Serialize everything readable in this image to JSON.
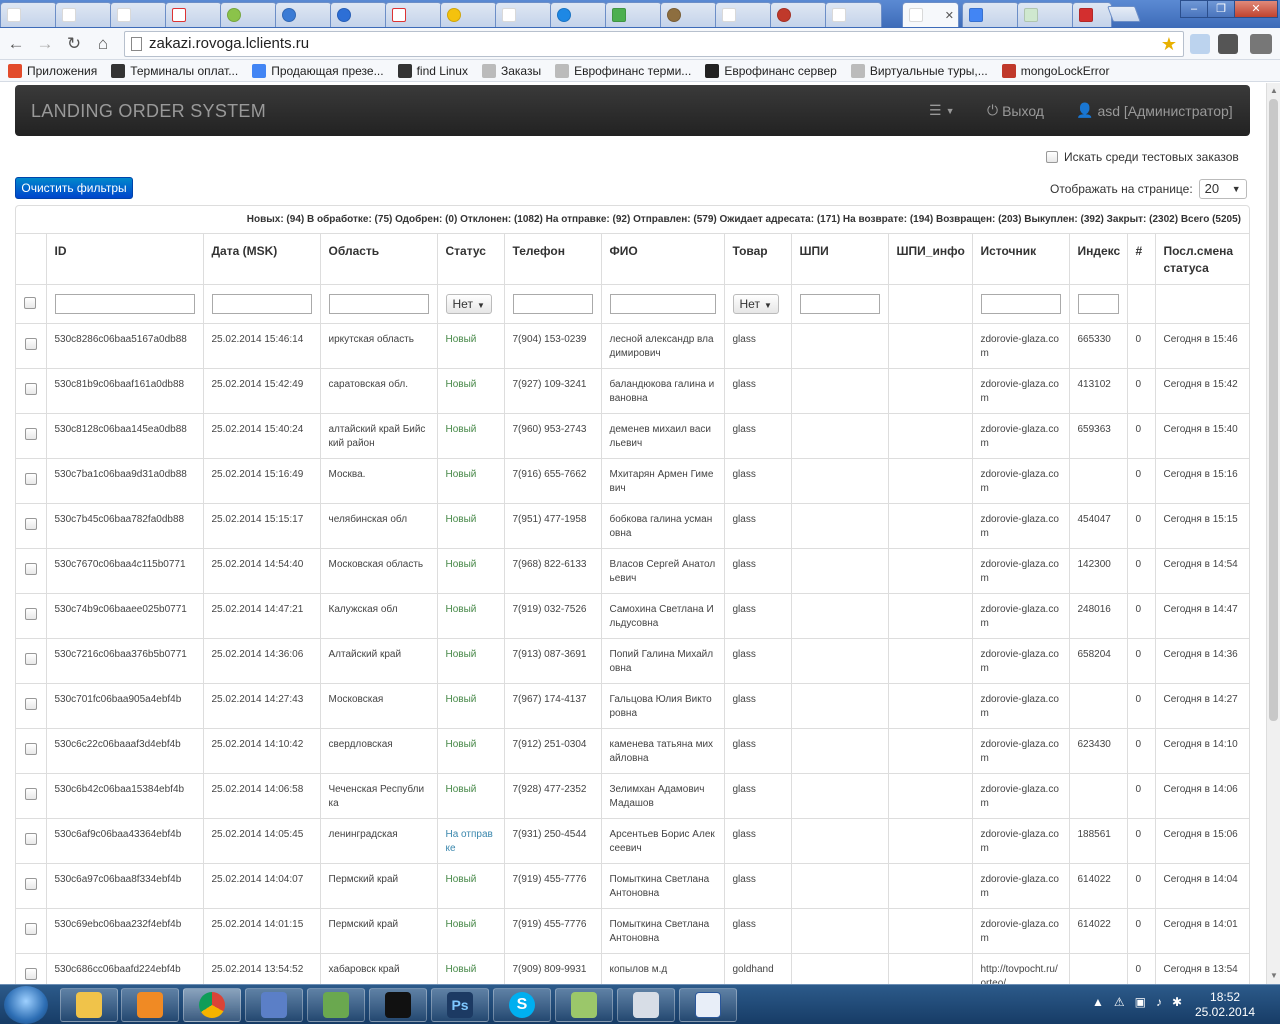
{
  "browser": {
    "url": "zakazi.rovoga.lclients.ru",
    "bookmarks": [
      {
        "label": "Приложения",
        "color": "#e24b2b"
      },
      {
        "label": "Терминалы оплат...",
        "color": "#333333"
      },
      {
        "label": "Продающая презе...",
        "color": "#4285f4"
      },
      {
        "label": "find Linux",
        "color": "#333333"
      },
      {
        "label": "Заказы",
        "color": "#bbbbbb"
      },
      {
        "label": "Еврофинанс терми...",
        "color": "#bbbbbb"
      },
      {
        "label": "Еврофинанс сервер",
        "color": "#222222"
      },
      {
        "label": "Виртуальные туры,...",
        "color": "#bbbbbb"
      },
      {
        "label": "mongoLockError",
        "color": "#c0392b"
      }
    ]
  },
  "app": {
    "brand": "LANDING ORDER SYSTEM",
    "logout": "Выход",
    "user": "asd [Администратор]",
    "search_test": "Искать среди тестовых заказов",
    "clear_filters": "Очистить фильтры",
    "per_page_label": "Отображать на странице:",
    "per_page_value": "20",
    "stats": "Новых: (94) В обработке: (75) Одобрен: (0) Отклонен: (1082) На отправке: (92) Отправлен: (579) Ожидает адресата: (171) На возврате: (194) Возвращен: (203) Выкуплен: (392) Закрыт: (2302) Всего (5205)",
    "filter_none": "Нет"
  },
  "table": {
    "columns": [
      "ID",
      "Дата (MSK)",
      "Область",
      "Статус",
      "Телефон",
      "ФИО",
      "Товар",
      "ШПИ",
      "ШПИ_инфо",
      "Источник",
      "Индекс",
      "#",
      "Посл.смена статуса"
    ],
    "rows": [
      [
        "530c8286c06baa5167a0db88",
        "25.02.2014 15:46:14",
        "иркутская область",
        "Новый",
        "7(904) 153-0239",
        "лесной александр владимирович",
        "glass",
        "",
        "",
        "zdorovie-glaza.com",
        "665330",
        "0",
        "Сегодня в 15:46"
      ],
      [
        "530c81b9c06baaf161a0db88",
        "25.02.2014 15:42:49",
        "саратовская обл.",
        "Новый",
        "7(927) 109-3241",
        "баландюкова галина ивановна",
        "glass",
        "",
        "",
        "zdorovie-glaza.com",
        "413102",
        "0",
        "Сегодня в 15:42"
      ],
      [
        "530c8128c06baa145ea0db88",
        "25.02.2014 15:40:24",
        "алтайский край Бийский район",
        "Новый",
        "7(960) 953-2743",
        "деменев михаил васильевич",
        "glass",
        "",
        "",
        "zdorovie-glaza.com",
        "659363",
        "0",
        "Сегодня в 15:40"
      ],
      [
        "530c7ba1c06baa9d31a0db88",
        "25.02.2014 15:16:49",
        "Москва.",
        "Новый",
        "7(916) 655-7662",
        "Мхитарян Армен Гимевич",
        "glass",
        "",
        "",
        "zdorovie-glaza.com",
        "",
        "0",
        "Сегодня в 15:16"
      ],
      [
        "530c7b45c06baa782fa0db88",
        "25.02.2014 15:15:17",
        "челябинская обл",
        "Новый",
        "7(951) 477-1958",
        "бобкова галина усмановна",
        "glass",
        "",
        "",
        "zdorovie-glaza.com",
        "454047",
        "0",
        "Сегодня в 15:15"
      ],
      [
        "530c7670c06baa4c115b0771",
        "25.02.2014 14:54:40",
        "Московская область",
        "Новый",
        "7(968) 822-6133",
        "Власов Сергей Анатольевич",
        "glass",
        "",
        "",
        "zdorovie-glaza.com",
        "142300",
        "0",
        "Сегодня в 14:54"
      ],
      [
        "530c74b9c06baaee025b0771",
        "25.02.2014 14:47:21",
        "Калужская обл",
        "Новый",
        "7(919) 032-7526",
        "Самохина Светлана Ильдусовна",
        "glass",
        "",
        "",
        "zdorovie-glaza.com",
        "248016",
        "0",
        "Сегодня в 14:47"
      ],
      [
        "530c7216c06baa376b5b0771",
        "25.02.2014 14:36:06",
        "Алтайский край",
        "Новый",
        "7(913) 087-3691",
        "Попий Галина Михайловна",
        "glass",
        "",
        "",
        "zdorovie-glaza.com",
        "658204",
        "0",
        "Сегодня в 14:36"
      ],
      [
        "530c701fc06baa905a4ebf4b",
        "25.02.2014 14:27:43",
        "Московская",
        "Новый",
        "7(967) 174-4137",
        "Гальцова Юлия Викторовна",
        "glass",
        "",
        "",
        "zdorovie-glaza.com",
        "",
        "0",
        "Сегодня в 14:27"
      ],
      [
        "530c6c22c06baaaf3d4ebf4b",
        "25.02.2014 14:10:42",
        "свердловская",
        "Новый",
        "7(912) 251-0304",
        "каменева татьяна михайловна",
        "glass",
        "",
        "",
        "zdorovie-glaza.com",
        "623430",
        "0",
        "Сегодня в 14:10"
      ],
      [
        "530c6b42c06baa15384ebf4b",
        "25.02.2014 14:06:58",
        "Чеченская Республика",
        "Новый",
        "7(928) 477-2352",
        "Зелимхан Адамович Мадашов",
        "glass",
        "",
        "",
        "zdorovie-glaza.com",
        "",
        "0",
        "Сегодня в 14:06"
      ],
      [
        "530c6af9c06baa43364ebf4b",
        "25.02.2014 14:05:45",
        "ленинградская",
        "На отправке",
        "7(931) 250-4544",
        "Арсентьев Борис Алексеевич",
        "glass",
        "",
        "",
        "zdorovie-glaza.com",
        "188561",
        "0",
        "Сегодня в 15:06"
      ],
      [
        "530c6a97c06baa8f334ebf4b",
        "25.02.2014 14:04:07",
        "Пермский край",
        "Новый",
        "7(919) 455-7776",
        "Помыткина Светлана Антоновна",
        "glass",
        "",
        "",
        "zdorovie-glaza.com",
        "614022",
        "0",
        "Сегодня в 14:04"
      ],
      [
        "530c69ebc06baa232f4ebf4b",
        "25.02.2014 14:01:15",
        "Пермский край",
        "Новый",
        "7(919) 455-7776",
        "Помыткина Светлана Антоновна",
        "glass",
        "",
        "",
        "zdorovie-glaza.com",
        "614022",
        "0",
        "Сегодня в 14:01"
      ],
      [
        "530c686cc06baafd224ebf4b",
        "25.02.2014 13:54:52",
        "хабаровск край",
        "Новый",
        "7(909) 809-9931",
        "копылов м.д",
        "goldhand",
        "",
        "",
        "http://tovpocht.ru/orteo/",
        "",
        "0",
        "Сегодня в 13:54"
      ]
    ]
  },
  "taskbar": {
    "time": "18:52",
    "date": "25.02.2014"
  },
  "colors": {
    "status_new": "#468847",
    "status_other": "#3a87ad",
    "primary_button": "#0088cc"
  }
}
